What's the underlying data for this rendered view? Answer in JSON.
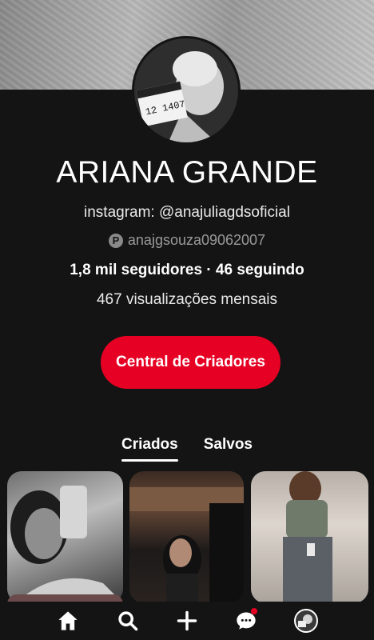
{
  "profile": {
    "name": "ARIANA GRANDE",
    "bio": "instagram: @anajuliagdsoficial",
    "pinterest_handle": "anajgsouza09062007",
    "follow_stats": "1,8 mil seguidores · 46 seguindo",
    "monthly_views": "467 visualizações mensais"
  },
  "cta": {
    "label": "Central de Criadores"
  },
  "tabs": [
    {
      "label": "Criados",
      "active": true
    },
    {
      "label": "Salvos",
      "active": false
    }
  ],
  "nav": {
    "items": [
      "home-icon",
      "search-icon",
      "plus-icon",
      "chat-icon",
      "profile-avatar"
    ],
    "notification_dot_color": "#e60023"
  },
  "colors": {
    "accent": "#e60023",
    "background": "#141414"
  }
}
